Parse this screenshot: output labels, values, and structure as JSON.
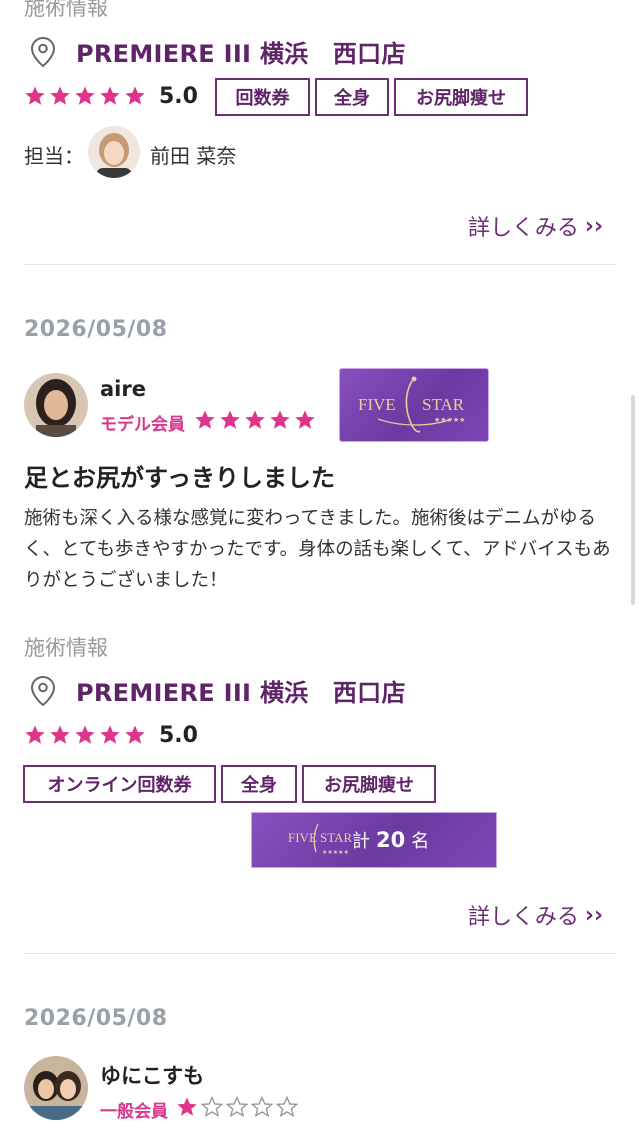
{
  "review1": {
    "section_label": "施術情報",
    "shop_name": "PREMIERE III 横浜　西口店",
    "rating": "5.0",
    "tags": [
      "回数券",
      "全身",
      "お尻脚痩せ"
    ],
    "staff_label": "担当：",
    "staff_name": "前田 菜奈",
    "more_label": "詳しくみる"
  },
  "review2": {
    "date": "2026/05/08",
    "nickname": "aire",
    "member_type": "モデル会員",
    "member_stars": 5,
    "badge_text": "FIVE STAR",
    "title": "足とお尻がすっきりしました",
    "body": "施術も深く入る様な感覚に変わってきました。施術後はデニムがゆるく、とても歩きやすかったです。身体の話も楽しくて、アドバイスもありがとうございました！",
    "section_label": "施術情報",
    "shop_name": "PREMIERE III 横浜　西口店",
    "rating": "5.0",
    "tags": [
      "オンライン回数券",
      "全身",
      "お尻脚痩せ"
    ],
    "count_badge": {
      "logo": "FIVE STAR",
      "prefix": "計",
      "count": "20",
      "suffix": "名"
    },
    "more_label": "詳しくみる"
  },
  "review3": {
    "date": "2026/05/08",
    "nickname": "ゆにこすも",
    "member_type": "一般会員",
    "member_stars": 1
  },
  "colors": {
    "accent": "#5e2467",
    "star": "#e0348c",
    "badge": "#7b44b0"
  }
}
